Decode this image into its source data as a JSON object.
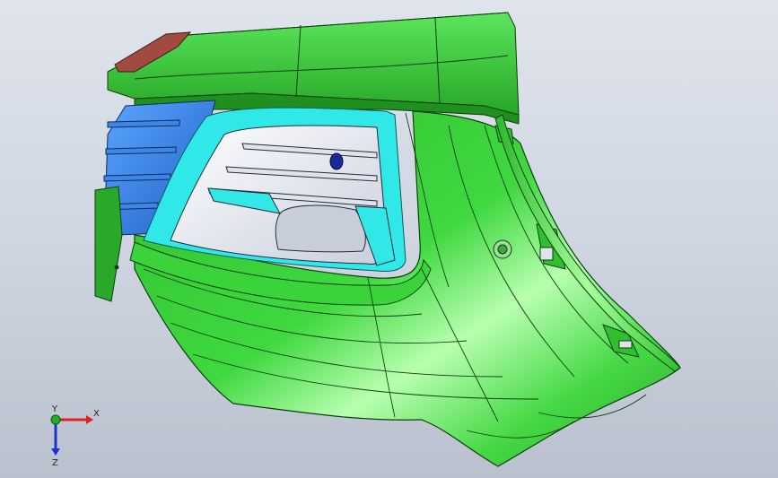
{
  "viewport": {
    "background_top": "#dfe4ec",
    "background_bottom": "#b9c1ce"
  },
  "model": {
    "name": "bumper-corner-part",
    "body_color": "#33cc33",
    "body_dark": "#1f8f1f",
    "highlight_color": "#c8ffc0",
    "inner_blue": "#2d7be0",
    "cyan_trim": "#30e8e8",
    "grille_white": "#eef0f6",
    "reflector_color": "#a04a40"
  },
  "triad": {
    "x_label": "X",
    "y_label": "Y",
    "z_label": "Z",
    "x_color": "#e02020",
    "y_color": "#20b020",
    "z_color": "#2030d0"
  }
}
